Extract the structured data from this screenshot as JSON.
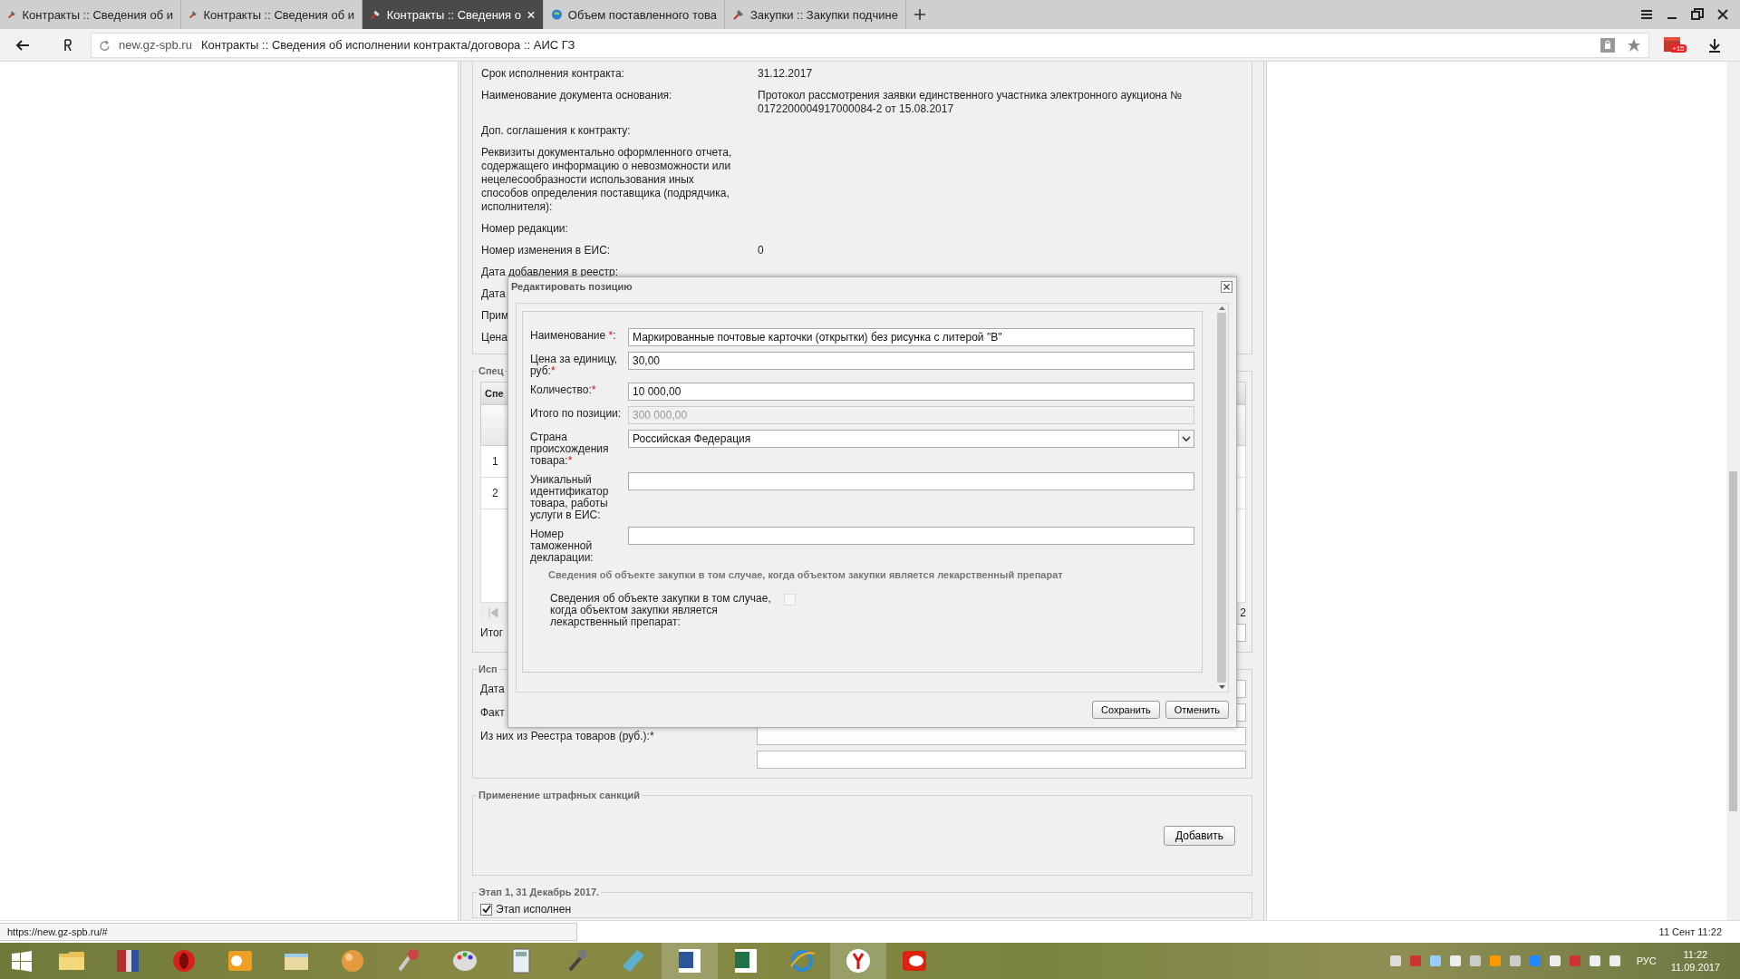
{
  "browser": {
    "tabs": [
      {
        "label": "Контракты :: Сведения об и",
        "selected": false
      },
      {
        "label": "Контракты :: Сведения об и",
        "selected": false
      },
      {
        "label": "Контракты :: Сведения о",
        "selected": true
      },
      {
        "label": "Объем поставленного това",
        "selected": false
      },
      {
        "label": "Закупки :: Закупки подчине",
        "selected": false
      }
    ],
    "address": {
      "domain": "new.gz-spb.ru",
      "title": "Контракты :: Сведения об исполнении контракта/договора :: АИС ГЗ"
    },
    "badge": "+15"
  },
  "page": {
    "details": [
      {
        "label": "Срок исполнения контракта:",
        "value": "31.12.2017"
      },
      {
        "label": "Наименование документа основания:",
        "value": "Протокол рассмотрения заявки единственного участника электронного аукциона № 0172200004917000084-2 от 15.08.2017"
      },
      {
        "label": "Доп. соглашения к контракту:"
      },
      {
        "label": "Реквизиты документально оформленного отчета, содержащего информацию о невозможности или нецелесообразности использования иных способов определения поставщика (подрядчика, исполнителя):"
      },
      {
        "label": "Номер редакции:"
      },
      {
        "label": "Номер изменения в ЕИС:",
        "value": "0"
      },
      {
        "label": "Дата добавления в реестр:"
      },
      {
        "label": "Дата"
      },
      {
        "label": "Прим"
      },
      {
        "label": "Цена"
      }
    ],
    "specification": {
      "legend": "Спец",
      "header": "Спе",
      "rows": [
        "1",
        "2"
      ],
      "pager": "2",
      "total_label": "Итог"
    },
    "execution": {
      "legend": "Исп",
      "labels": [
        "Дата",
        "Факт",
        "Из них из Реестра товаров (руб.):*"
      ]
    },
    "penalties": {
      "legend": "Применение штрафных санкций",
      "button": "Добавить"
    },
    "stage": {
      "legend": "Этап 1, 31 Декабрь 2017.",
      "checkbox": {
        "label": "Этап исполнен",
        "checked": true
      }
    }
  },
  "dialog": {
    "title": "Редактировать позицию",
    "fields": [
      {
        "kind": "text",
        "label": "Наименование ",
        "mark": "*",
        "label_end": ":",
        "value": "Маркированные почтовые карточки (открытки) без рисунка с литерой \"В\"",
        "disabled": false
      },
      {
        "kind": "text",
        "label": "Цена за единицу, руб:",
        "mark": "*",
        "value": "30,00",
        "disabled": false
      },
      {
        "kind": "text",
        "label": "Количество:",
        "mark": "*",
        "value": "10 000,00",
        "disabled": false
      },
      {
        "kind": "text",
        "label": "Итого по позиции:",
        "value": "300 000,00",
        "disabled": true
      },
      {
        "kind": "select",
        "label": "Страна происхождения товара:",
        "mark": "*",
        "value": "Российская Федерация",
        "disabled": false
      },
      {
        "kind": "text",
        "label": "Уникальный идентификатор товара, работы услуги в ЕИС:",
        "disabled": false
      },
      {
        "kind": "text",
        "label": "Номер таможенной декларации:",
        "disabled": false
      }
    ],
    "section_title": "Сведения об объекте закупки в том случае, когда объектом закупки является лекарственный препарат",
    "checkbox": {
      "label": "Сведения об объекте закупки в том случае, когда объектом закупки является лекарственный препарат:",
      "checked": false
    },
    "buttons": [
      "Сохранить",
      "Отменить"
    ]
  },
  "status_bar": {
    "url": "https://new.gz-spb.ru/#",
    "datetime": "11 Сент 11:22"
  },
  "taskbar": {
    "language": "РУС",
    "time": "11:22",
    "date": "11.09.2017"
  }
}
